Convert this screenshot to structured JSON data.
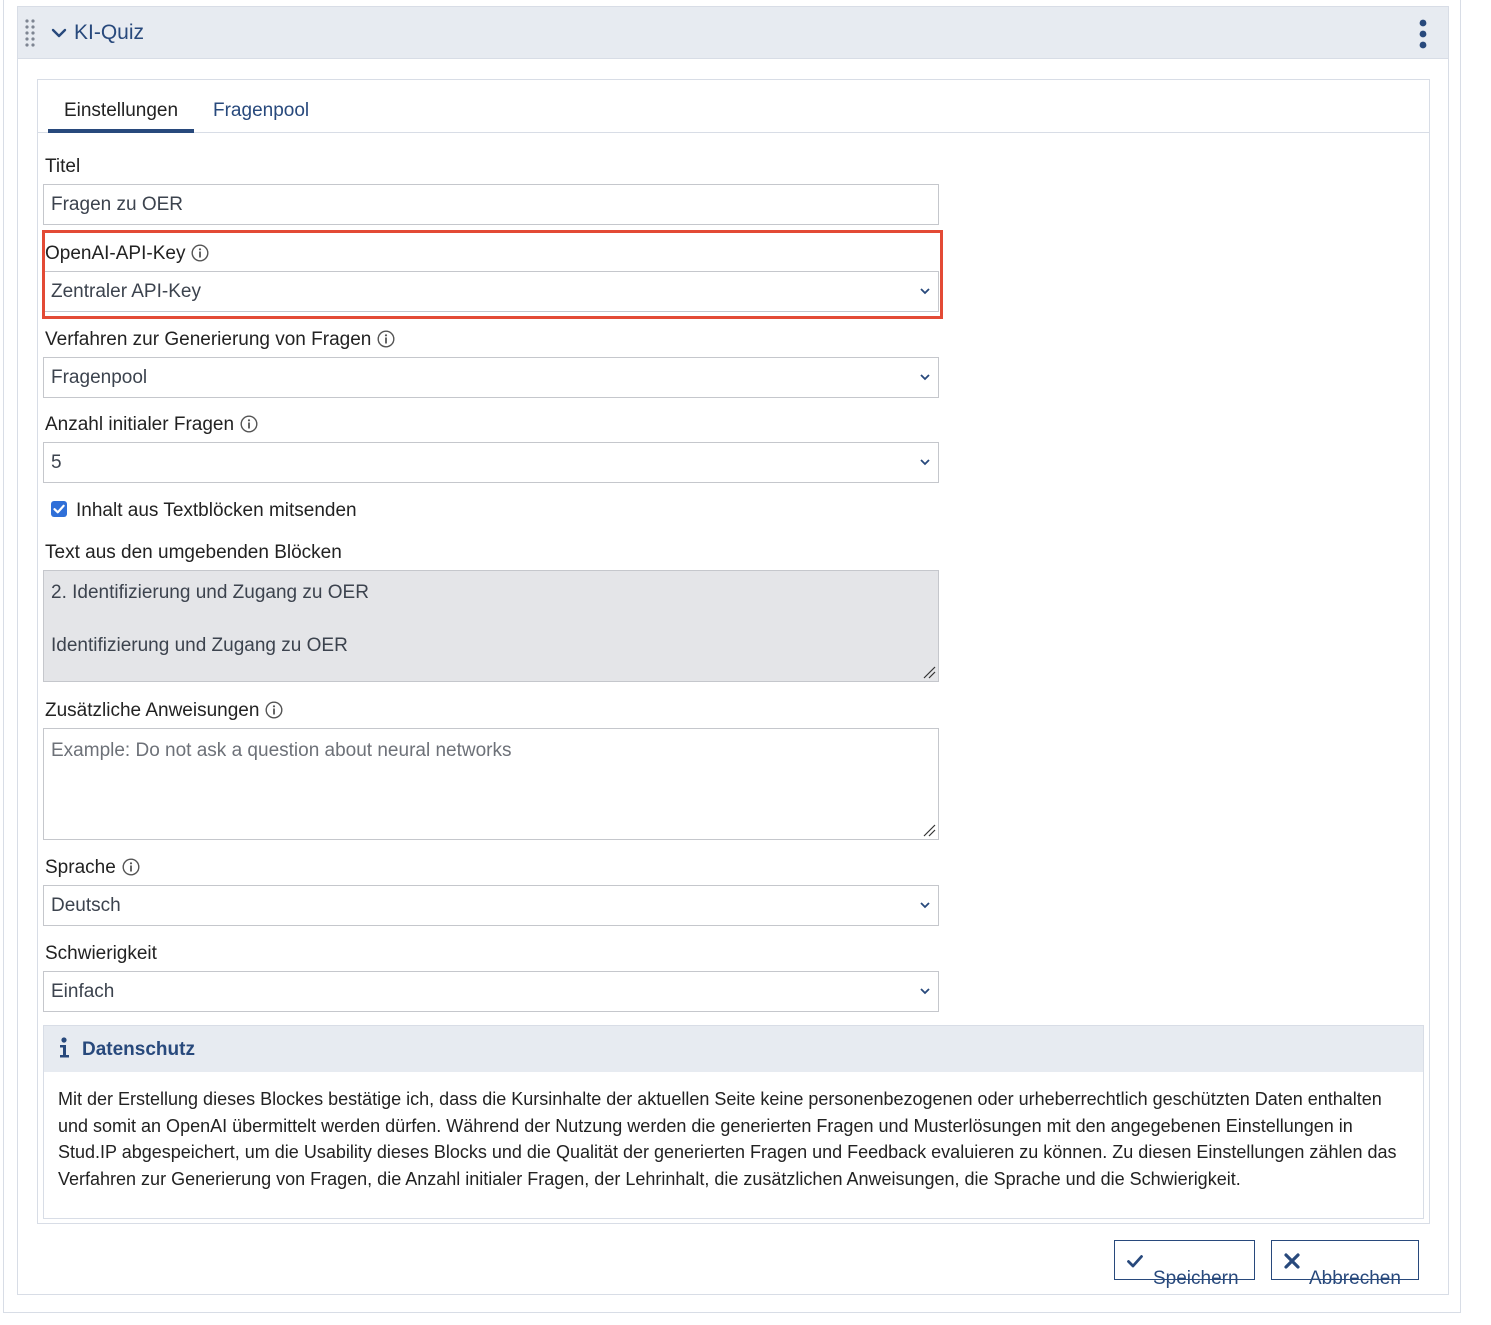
{
  "block": {
    "title": "KI-Quiz"
  },
  "tabs": [
    {
      "label": "Einstellungen",
      "active": true
    },
    {
      "label": "Fragenpool",
      "active": false
    }
  ],
  "form": {
    "title_label": "Titel",
    "title_value": "Fragen zu OER",
    "api_key_label": "OpenAI-API-Key",
    "api_key_value": "Zentraler API-Key",
    "method_label": "Verfahren zur Generierung von Fragen",
    "method_value": "Fragenpool",
    "count_label": "Anzahl initialer Fragen",
    "count_value": "5",
    "send_content_label": "Inhalt aus Textblöcken mitsenden",
    "send_content_checked": true,
    "surrounding_text_label": "Text aus den umgebenden Blöcken",
    "surrounding_text_line1": "2. Identifizierung und Zugang zu OER",
    "surrounding_text_line2": "Identifizierung und Zugang zu OER",
    "instructions_label": "Zusätzliche Anweisungen",
    "instructions_placeholder": "Example: Do not ask a question about neural networks",
    "language_label": "Sprache",
    "language_value": "Deutsch",
    "difficulty_label": "Schwierigkeit",
    "difficulty_value": "Einfach"
  },
  "privacy": {
    "title": "Datenschutz",
    "text": "Mit der Erstellung dieses Blockes bestätige ich, dass die Kursinhalte der aktuellen Seite keine personenbezogenen oder urheberrechtlich geschützten Daten enthalten und somit an OpenAI übermittelt werden dürfen. Während der Nutzung werden die generierten Fragen und Musterlösungen mit den angegebenen Einstellungen in Stud.IP abgespeichert, um die Usability dieses Blocks und die Qualität der generierten Fragen und Feedback evaluieren zu können. Zu diesen Einstellungen zählen das Verfahren zur Generierung von Fragen, die Anzahl initialer Fragen, der Lehrinhalt, die zusätzlichen Anweisungen, die Sprache und die Schwierigkeit."
  },
  "actions": {
    "save_label": "Speichern",
    "cancel_label": "Abbrechen"
  },
  "icons": {
    "drag": "drag-handle-icon",
    "collapse": "chevron-down-icon",
    "menu": "kebab-menu-icon",
    "info": "info-icon",
    "save": "checkmark-icon",
    "cancel": "close-icon"
  },
  "colors": {
    "brand": "#28497c",
    "header_bg": "#e7ebf1",
    "highlight": "#e34a35",
    "checkbox": "#2f6fd8"
  }
}
